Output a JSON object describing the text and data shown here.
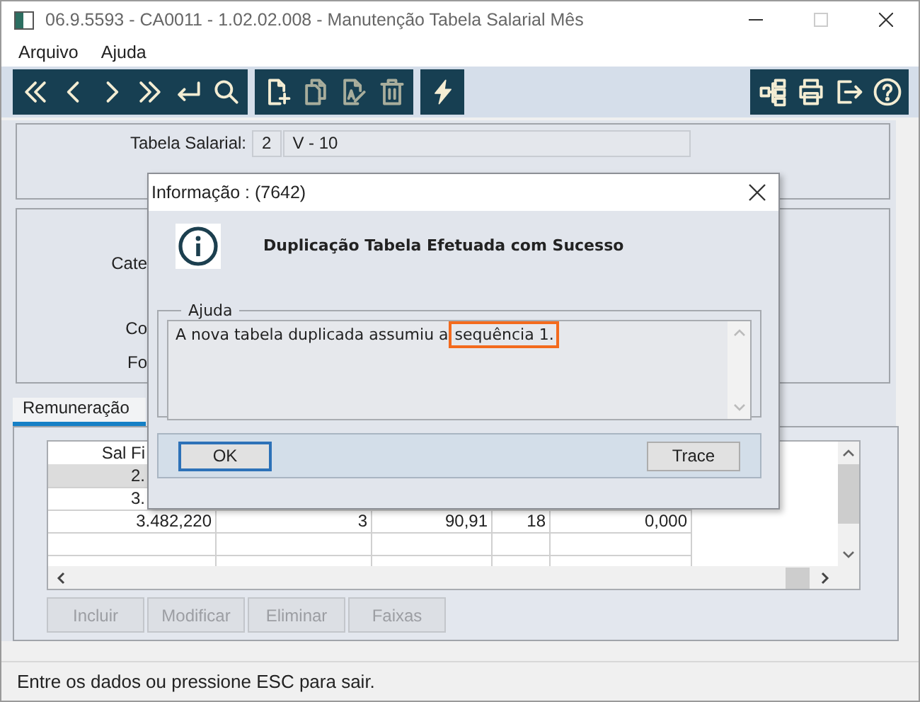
{
  "window": {
    "title": "06.9.5593 - CA0011 - 1.02.02.008 - Manutenção Tabela Salarial Mês"
  },
  "menu": [
    "Arquivo",
    "Ajuda"
  ],
  "toolbar": [
    {
      "icons": [
        {
          "kind": "first",
          "disabled": false
        },
        {
          "kind": "prev",
          "disabled": false
        },
        {
          "kind": "next",
          "disabled": false
        },
        {
          "kind": "last",
          "disabled": false
        },
        {
          "kind": "enter",
          "disabled": false
        },
        {
          "kind": "search",
          "disabled": false
        }
      ]
    },
    {
      "icons": [
        {
          "kind": "new",
          "disabled": false
        },
        {
          "kind": "copy",
          "disabled": true
        },
        {
          "kind": "edit",
          "disabled": true
        },
        {
          "kind": "trash",
          "disabled": true
        }
      ]
    },
    {
      "icons": [
        {
          "kind": "bolt",
          "disabled": false
        }
      ]
    },
    {
      "icons": [
        {
          "kind": "tree",
          "disabled": false
        },
        {
          "kind": "print",
          "disabled": false
        },
        {
          "kind": "exit",
          "disabled": false
        },
        {
          "kind": "help",
          "disabled": false
        }
      ]
    }
  ],
  "form": {
    "label": "Tabela Salarial:",
    "code": "2",
    "value": "V - 10",
    "cut_labels": [
      "Cate",
      "Co",
      "Fo"
    ]
  },
  "tabs": [
    {
      "label": "Remuneração",
      "selected": true
    }
  ],
  "table": {
    "columns": [
      "Sal Fi"
    ],
    "rows": [
      {
        "cells": [
          "2."
        ],
        "selected": true
      },
      {
        "cells": [
          "3."
        ],
        "selected": false
      },
      {
        "cells": [
          "3.482,220",
          "3",
          "90,91",
          "18",
          "0,000"
        ],
        "selected": false
      }
    ]
  },
  "buttons": [
    {
      "label": "Incluir",
      "disabled": true
    },
    {
      "label": "Modificar",
      "disabled": true
    },
    {
      "label": "Eliminar",
      "disabled": true
    },
    {
      "label": "Faixas",
      "disabled": true
    }
  ],
  "status_bar": "Entre os dados ou pressione ESC para sair.",
  "dialog": {
    "title": "Informação : (7642)",
    "message": "Duplicação Tabela Efetuada com Sucesso",
    "group_label": "Ajuda",
    "text": "A nova tabela duplicada assumiu a",
    "highlighted_text": "sequência 1.",
    "buttons": [
      {
        "label": "OK",
        "focused": true
      },
      {
        "label": "Trace",
        "focused": false
      }
    ]
  }
}
